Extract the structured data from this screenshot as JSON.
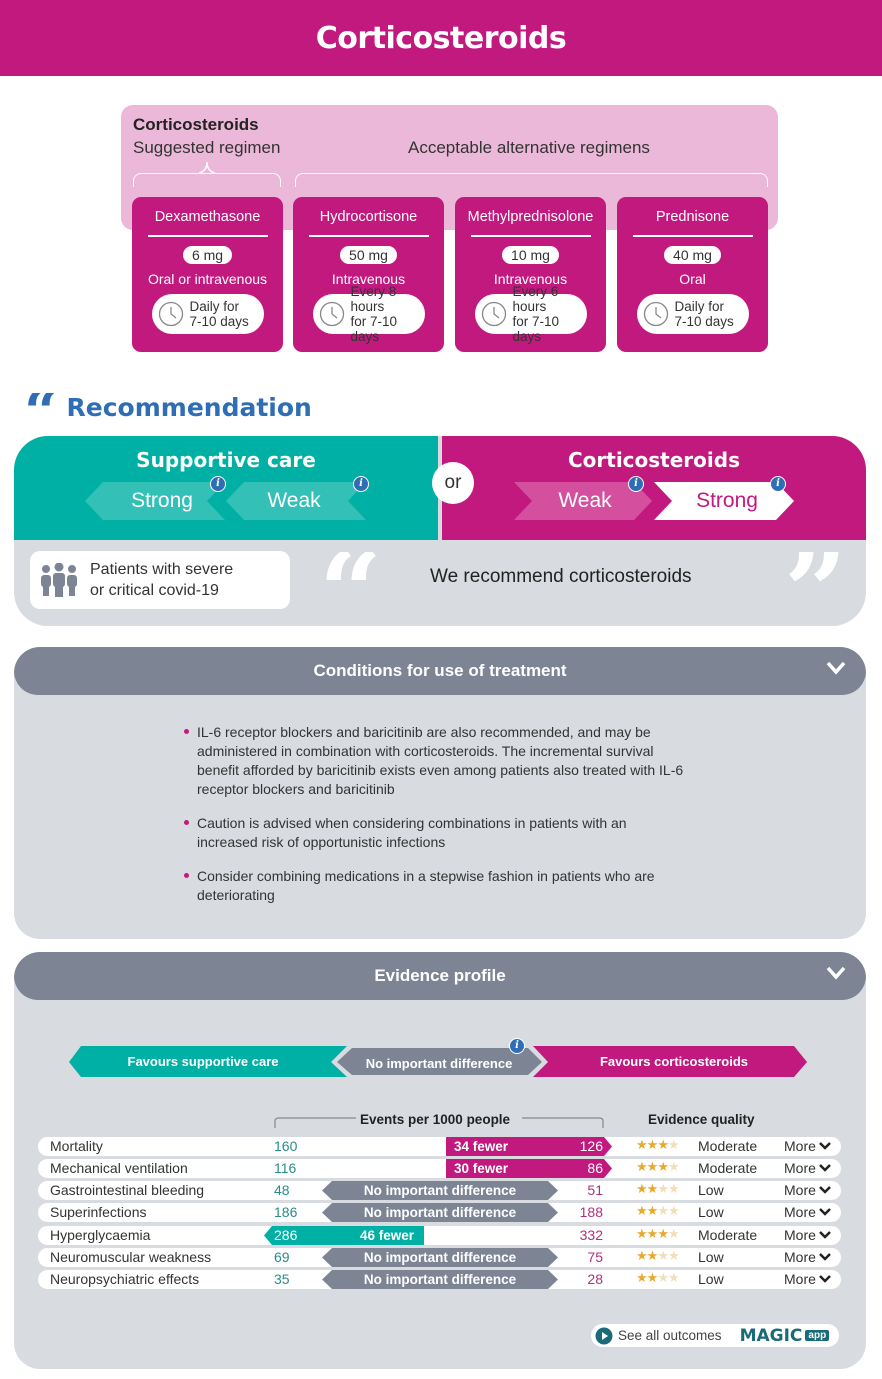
{
  "header": {
    "title": "Corticosteroids"
  },
  "regimen": {
    "title": "Corticosteroids",
    "suggested_label": "Suggested regimen",
    "alternative_label": "Acceptable alternative regimens",
    "drugs": [
      {
        "name": "Dexamethasone",
        "dose": "6 mg",
        "route": "Oral or intravenous",
        "freq1": "Daily for",
        "freq2": "7-10 days"
      },
      {
        "name": "Hydrocortisone",
        "dose": "50 mg",
        "route": "Intravenous",
        "freq1": "Every 8 hours",
        "freq2": "for 7-10 days"
      },
      {
        "name": "Methylprednisolone",
        "dose": "10 mg",
        "route": "Intravenous",
        "freq1": "Every 6 hours",
        "freq2": "for 7-10 days"
      },
      {
        "name": "Prednisone",
        "dose": "40 mg",
        "route": "Oral",
        "freq1": "Daily for",
        "freq2": "7-10 days"
      }
    ]
  },
  "recommendation": {
    "heading": "Recommendation",
    "left": {
      "title": "Supportive care",
      "options": [
        "Strong",
        "Weak"
      ]
    },
    "or_label": "or",
    "right": {
      "title": "Corticosteroids",
      "options": [
        "Weak",
        "Strong"
      ],
      "selected": "Strong"
    },
    "population_line1": "Patients with severe",
    "population_line2": "or critical covid-19",
    "text": "We recommend corticosteroids"
  },
  "conditions": {
    "title": "Conditions for use of treatment",
    "bullets": [
      "IL-6 receptor blockers and baricitinib are also recommended, and may be administered in combination with corticosteroids. The incremental survival benefit afforded by baricitinib exists even among patients also treated with IL-6 receptor blockers and baricitinib",
      "Caution is advised when considering combinations in patients with an increased risk of opportunistic infections",
      "Consider combining medications in a stepwise fashion in patients who are deteriorating"
    ]
  },
  "evidence": {
    "title": "Evidence profile",
    "legend": {
      "left": "Favours supportive care",
      "middle": "No important difference",
      "right": "Favours corticosteroids"
    },
    "events_header": "Events per 1000 people",
    "quality_header": "Evidence quality",
    "more_label": "More",
    "outcomes": [
      {
        "name": "Mortality",
        "control": "160",
        "treatment": "126",
        "effect": "34 fewer",
        "direction": "favours-treatment",
        "stars": 3,
        "quality": "Moderate"
      },
      {
        "name": "Mechanical ventilation",
        "control": "116",
        "treatment": "86",
        "effect": "30 fewer",
        "direction": "favours-treatment",
        "stars": 3,
        "quality": "Moderate"
      },
      {
        "name": "Gastrointestinal bleeding",
        "control": "48",
        "treatment": "51",
        "effect": "No important difference",
        "direction": "none",
        "stars": 2,
        "quality": "Low"
      },
      {
        "name": "Superinfections",
        "control": "186",
        "treatment": "188",
        "effect": "No important difference",
        "direction": "none",
        "stars": 2,
        "quality": "Low"
      },
      {
        "name": "Hyperglycaemia",
        "control": "286",
        "treatment": "332",
        "effect": "46 fewer",
        "direction": "favours-control",
        "stars": 3,
        "quality": "Moderate"
      },
      {
        "name": "Neuromuscular weakness",
        "control": "69",
        "treatment": "75",
        "effect": "No important difference",
        "direction": "none",
        "stars": 2,
        "quality": "Low"
      },
      {
        "name": "Neuropsychiatric effects",
        "control": "35",
        "treatment": "28",
        "effect": "No important difference",
        "direction": "none",
        "stars": 2,
        "quality": "Low"
      }
    ],
    "see_all": "See all outcomes",
    "brand": "MAGIC",
    "brand_badge": "app"
  },
  "colors": {
    "magenta": "#c2197f",
    "teal": "#00b0a5",
    "grey": "#7d8595",
    "blue": "#2f6db4"
  }
}
